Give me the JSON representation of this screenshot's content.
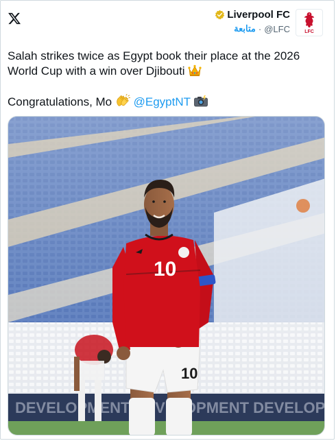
{
  "author": {
    "name": "Liverpool FC",
    "handle": "@LFC",
    "follow_label": "متابعة",
    "separator": "·"
  },
  "tweet": {
    "line1": "Salah strikes twice as Egypt book their place at the 2026",
    "line2": "World Cup with a win over Djibouti",
    "congrats": "Congratulations, Mo",
    "mention": "@EgyptNT"
  },
  "media": {
    "shirt_number": "10",
    "shorts_number": "10",
    "banner_text": "DEVELOPMENT DEVELOPMENT DEVELOPM"
  },
  "colors": {
    "link": "#1d9bf0",
    "verified_gold": "#e2b719",
    "kit_red": "#d0101b",
    "lfc_red": "#c8102e"
  }
}
